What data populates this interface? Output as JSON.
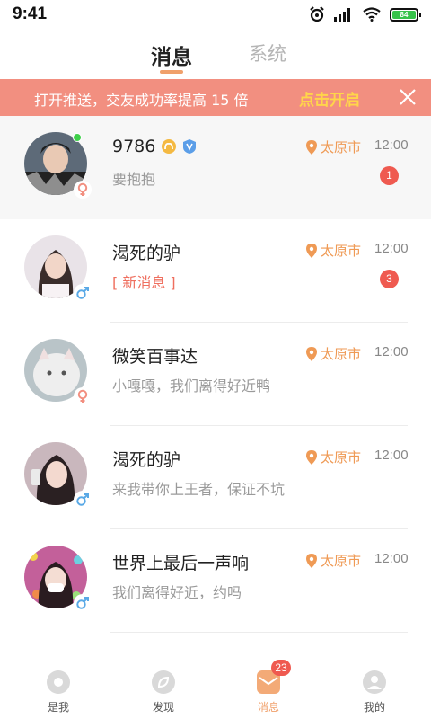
{
  "status_bar": {
    "time": "9:41",
    "battery": "84"
  },
  "tabs": [
    {
      "label": "消息",
      "active": true
    },
    {
      "label": "系统",
      "active": false
    }
  ],
  "banner": {
    "text": "打开推送，交友成功率提高 15 倍",
    "action": "点击开启"
  },
  "messages": [
    {
      "name": "9786",
      "preview": "要抱抱",
      "location": "太原市",
      "time": "12:00",
      "unread": "1",
      "gender": "female",
      "online": true,
      "highlight": true
    },
    {
      "name": "渴死的驴",
      "preview": "[ 新消息 ]",
      "location": "太原市",
      "time": "12:00",
      "unread": "3",
      "gender": "male"
    },
    {
      "name": "微笑百事达",
      "preview": "小嘎嘎，我们离得好近鸭",
      "location": "太原市",
      "time": "12:00",
      "gender": "female"
    },
    {
      "name": "渴死的驴",
      "preview": "来我带你上王者，保证不坑",
      "location": "太原市",
      "time": "12:00",
      "gender": "male"
    },
    {
      "name": "世界上最后一声响",
      "preview": "我们离得好近，约吗",
      "location": "太原市",
      "time": "12:00",
      "gender": "male"
    }
  ],
  "bottom_nav": [
    {
      "label": "是我",
      "icon": "disc-icon"
    },
    {
      "label": "发现",
      "icon": "leaf-icon"
    },
    {
      "label": "消息",
      "icon": "message-icon",
      "active": true,
      "badge": "23"
    },
    {
      "label": "我的",
      "icon": "profile-icon"
    }
  ],
  "colors": {
    "accent": "#f0a06b",
    "banner": "#f28f80",
    "unread": "#ef5a50",
    "location": "#ef9a55"
  }
}
